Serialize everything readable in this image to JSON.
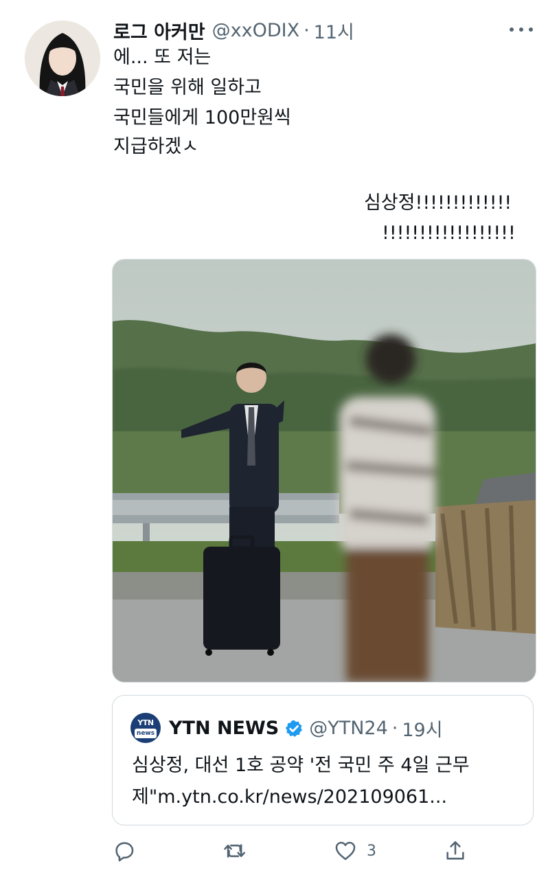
{
  "tweet": {
    "display_name": "로그 아커만",
    "handle": "@xxODIX",
    "separator": "·",
    "time": "11시",
    "lines": [
      "에... 또 저는",
      "국민을 위해 일하고",
      "국민들에게 100만원씩",
      "지급하겠ㅅ"
    ],
    "shout_lines": [
      "심상정!!!!!!!!!!!!!",
      "!!!!!!!!!!!!!!!!!!"
    ]
  },
  "quote": {
    "logo_top": "YTN",
    "logo_bottom": "news",
    "display_name": "YTN NEWS",
    "handle": "@YTN24",
    "separator": "·",
    "time": "19시",
    "lines": [
      "심상정, 대선 1호 공약 '전 국민 주 4일 근무",
      "제\"m.ytn.co.kr/news/202109061..."
    ]
  },
  "actions": {
    "reply_icon": "reply-icon",
    "retweet_icon": "retweet-icon",
    "like_icon": "heart-icon",
    "like_count": "3",
    "share_icon": "share-icon"
  },
  "colors": {
    "text": "#0f1419",
    "secondary": "#536471",
    "verified": "#1d9bf0",
    "border": "#cfd9de"
  }
}
